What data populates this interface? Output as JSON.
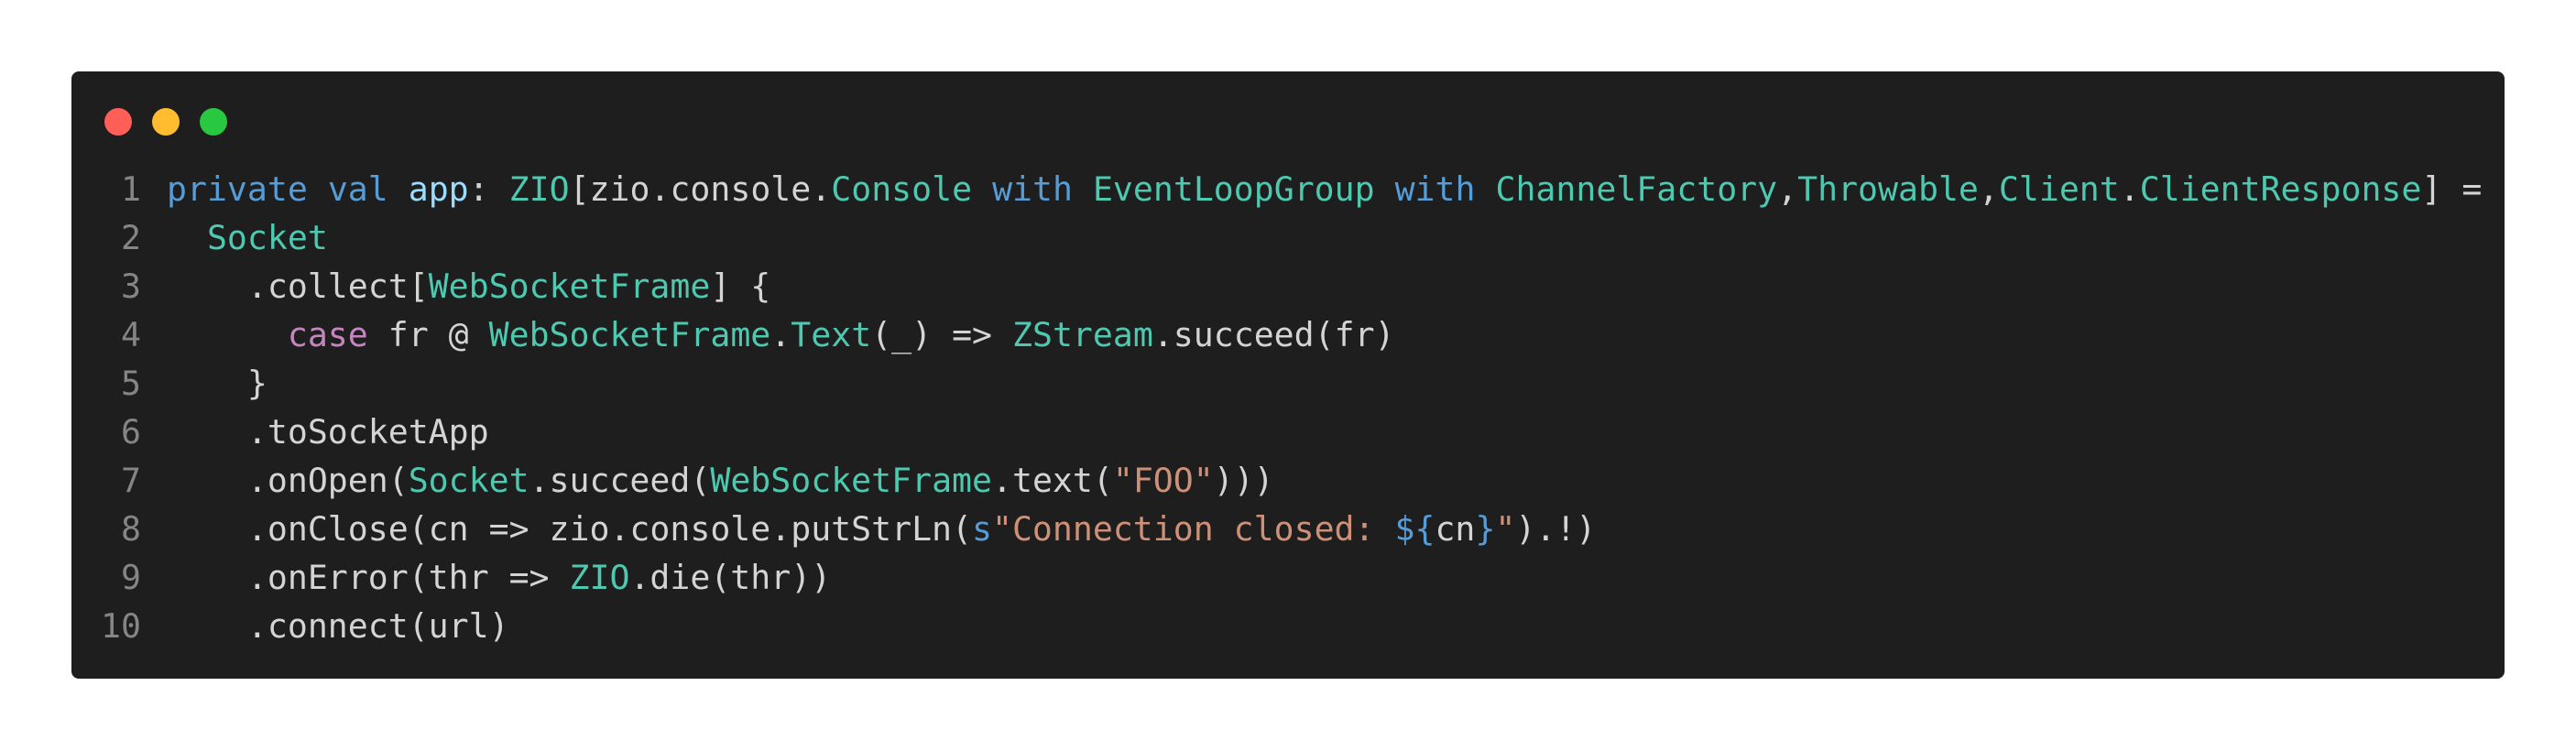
{
  "window": {
    "traffic_lights": [
      {
        "name": "close",
        "color": "#ff5f57"
      },
      {
        "name": "minimize",
        "color": "#febc2e"
      },
      {
        "name": "zoom",
        "color": "#28c840"
      }
    ]
  },
  "colors": {
    "background": "#1e1e1e",
    "plain": "#d4d4d4",
    "keyword": "#569cd6",
    "control_keyword": "#c586c0",
    "type": "#4ec9b0",
    "variable": "#9cdcfe",
    "string": "#ce9178",
    "line_number": "#858585"
  },
  "code": {
    "language": "scala",
    "lines": [
      {
        "num": "1",
        "tokens": [
          {
            "t": "private",
            "k": "kw"
          },
          {
            "t": " ",
            "k": "plain"
          },
          {
            "t": "val",
            "k": "kw"
          },
          {
            "t": " ",
            "k": "plain"
          },
          {
            "t": "app",
            "k": "var"
          },
          {
            "t": ": ",
            "k": "plain"
          },
          {
            "t": "ZIO",
            "k": "type"
          },
          {
            "t": "[zio.console.",
            "k": "plain"
          },
          {
            "t": "Console",
            "k": "type"
          },
          {
            "t": " ",
            "k": "plain"
          },
          {
            "t": "with",
            "k": "kw"
          },
          {
            "t": " ",
            "k": "plain"
          },
          {
            "t": "EventLoopGroup",
            "k": "type"
          },
          {
            "t": " ",
            "k": "plain"
          },
          {
            "t": "with",
            "k": "kw"
          },
          {
            "t": " ",
            "k": "plain"
          },
          {
            "t": "ChannelFactory",
            "k": "type"
          },
          {
            "t": ",",
            "k": "plain"
          },
          {
            "t": "Throwable",
            "k": "type"
          },
          {
            "t": ",",
            "k": "plain"
          },
          {
            "t": "Client",
            "k": "type"
          },
          {
            "t": ".",
            "k": "plain"
          },
          {
            "t": "ClientResponse",
            "k": "type"
          },
          {
            "t": "] =",
            "k": "plain"
          }
        ]
      },
      {
        "num": "2",
        "tokens": [
          {
            "t": "  ",
            "k": "plain"
          },
          {
            "t": "Socket",
            "k": "type"
          }
        ]
      },
      {
        "num": "3",
        "tokens": [
          {
            "t": "    .collect[",
            "k": "plain"
          },
          {
            "t": "WebSocketFrame",
            "k": "type"
          },
          {
            "t": "] {",
            "k": "plain"
          }
        ]
      },
      {
        "num": "4",
        "tokens": [
          {
            "t": "      ",
            "k": "plain"
          },
          {
            "t": "case",
            "k": "kw2"
          },
          {
            "t": " fr @ ",
            "k": "plain"
          },
          {
            "t": "WebSocketFrame",
            "k": "type"
          },
          {
            "t": ".",
            "k": "plain"
          },
          {
            "t": "Text",
            "k": "type"
          },
          {
            "t": "(_) => ",
            "k": "plain"
          },
          {
            "t": "ZStream",
            "k": "type"
          },
          {
            "t": ".succeed(fr)",
            "k": "plain"
          }
        ]
      },
      {
        "num": "5",
        "tokens": [
          {
            "t": "    }",
            "k": "plain"
          }
        ]
      },
      {
        "num": "6",
        "tokens": [
          {
            "t": "    .toSocketApp",
            "k": "plain"
          }
        ]
      },
      {
        "num": "7",
        "tokens": [
          {
            "t": "    .onOpen(",
            "k": "plain"
          },
          {
            "t": "Socket",
            "k": "type"
          },
          {
            "t": ".succeed(",
            "k": "plain"
          },
          {
            "t": "WebSocketFrame",
            "k": "type"
          },
          {
            "t": ".text(",
            "k": "plain"
          },
          {
            "t": "\"FOO\"",
            "k": "str"
          },
          {
            "t": "))) ",
            "k": "plain"
          }
        ]
      },
      {
        "num": "8",
        "tokens": [
          {
            "t": "    .onClose(cn => zio.console.putStrLn(",
            "k": "plain"
          },
          {
            "t": "s",
            "k": "kw"
          },
          {
            "t": "\"Connection closed: ",
            "k": "str"
          },
          {
            "t": "${",
            "k": "kw"
          },
          {
            "t": "cn",
            "k": "plain"
          },
          {
            "t": "}",
            "k": "kw"
          },
          {
            "t": "\"",
            "k": "str"
          },
          {
            "t": ").!)",
            "k": "plain"
          }
        ]
      },
      {
        "num": "9",
        "tokens": [
          {
            "t": "    .onError(thr => ",
            "k": "plain"
          },
          {
            "t": "ZIO",
            "k": "type"
          },
          {
            "t": ".die(thr))",
            "k": "plain"
          }
        ]
      },
      {
        "num": "10",
        "tokens": [
          {
            "t": "    .connect(url)",
            "k": "plain"
          }
        ]
      }
    ]
  }
}
